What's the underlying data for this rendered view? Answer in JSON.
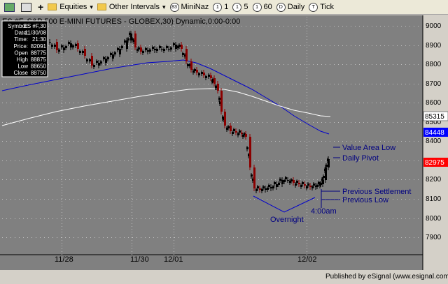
{
  "toolbar": {
    "items": [
      {
        "name": "layout-icon",
        "label": ""
      },
      {
        "name": "chart-icon",
        "label": ""
      },
      {
        "name": "add-icon",
        "label": "+"
      },
      {
        "name": "equities-menu",
        "label": "Equities"
      },
      {
        "name": "other-intervals-menu",
        "label": "Other Intervals"
      },
      {
        "name": "mininaz-button",
        "label": "MiniNaz",
        "badge": "83"
      },
      {
        "name": "interval-1-button",
        "label": "1",
        "badge": "1"
      },
      {
        "name": "interval-5-button",
        "label": "5",
        "badge": "1"
      },
      {
        "name": "interval-60-button",
        "label": "60",
        "badge": "1"
      },
      {
        "name": "daily-button",
        "label": "Daily",
        "badge": "D"
      },
      {
        "name": "tick-button",
        "label": "Tick",
        "badge": "T"
      }
    ],
    "dropdown_arrow": "▾"
  },
  "chart": {
    "header": "ES #F,  S&P 500 E-MINI FUTURES - GLOBEX,30) Dynamic,0:00-0:00",
    "colors": {
      "background": "#808080",
      "up": "#000000",
      "down": "#8b0000",
      "ma_blue": "#0000cc",
      "ma_white": "#ffffff",
      "annotation": "#000080",
      "price_box_red": "#ff0000",
      "price_box_blue": "#0000ff",
      "price_box_gray": "#a0a0a0"
    },
    "price_axis": [
      "9000",
      "8900",
      "8800",
      "8700",
      "8600",
      "8500",
      "8400",
      "8300",
      "8200",
      "8100",
      "8000",
      "7900"
    ],
    "price_labels": {
      "gray": "85315",
      "blue": "84448",
      "red": "82975"
    },
    "date_labels": [
      "11/28",
      "11/30",
      "12/01",
      "12/02"
    ],
    "annotations": [
      "Value Area Low",
      "Daily Pivot",
      "Previous Settlement",
      "Previous Low",
      "4:00am",
      "Overnight"
    ],
    "footer": "Published by eSignal (www.esignal.com)"
  },
  "data_window": {
    "rows": [
      {
        "label": "Symbol:",
        "value": "ES #F,30"
      },
      {
        "label": "Date:",
        "value": "11/30/08"
      },
      {
        "label": "Time:",
        "value": "21:30"
      },
      {
        "label": "Price:",
        "value": "82091"
      },
      {
        "label": "Open",
        "value": "88775"
      },
      {
        "label": "High",
        "value": "88875"
      },
      {
        "label": "Low",
        "value": "88650"
      },
      {
        "label": "Close",
        "value": "88750"
      }
    ]
  }
}
